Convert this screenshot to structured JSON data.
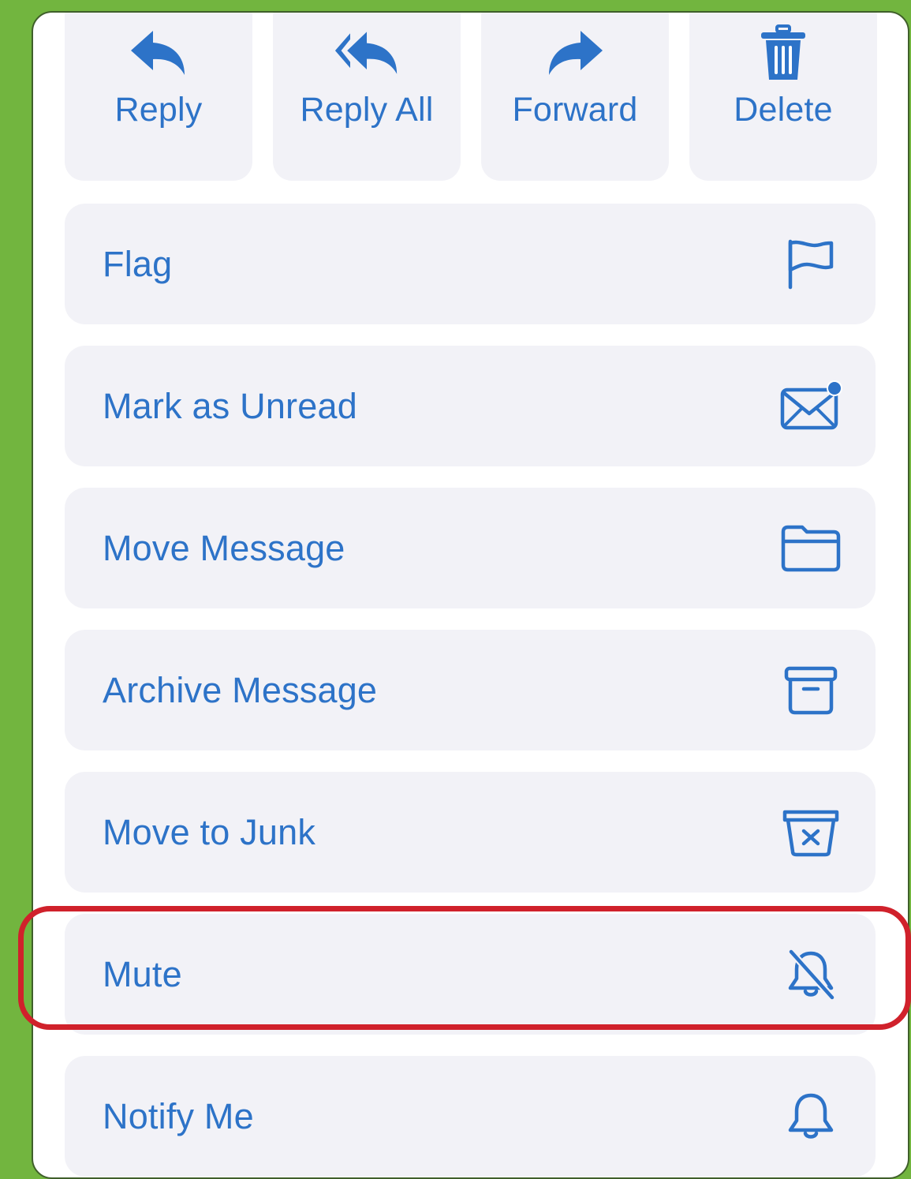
{
  "colors": {
    "accent": "#2d73c8",
    "page_background": "#72b53f",
    "row_background": "#f2f2f7",
    "highlight": "#d0212b"
  },
  "actions": [
    {
      "label": "Reply",
      "icon": "reply-icon"
    },
    {
      "label": "Reply All",
      "icon": "reply-all-icon"
    },
    {
      "label": "Forward",
      "icon": "forward-icon"
    },
    {
      "label": "Delete",
      "icon": "trash-icon"
    }
  ],
  "menu": [
    {
      "label": "Flag",
      "icon": "flag-icon"
    },
    {
      "label": "Mark as Unread",
      "icon": "envelope-unread-icon"
    },
    {
      "label": "Move Message",
      "icon": "folder-icon"
    },
    {
      "label": "Archive Message",
      "icon": "archive-box-icon"
    },
    {
      "label": "Move to Junk",
      "icon": "junk-box-icon"
    },
    {
      "label": "Mute",
      "icon": "bell-slash-icon",
      "highlighted": true
    },
    {
      "label": "Notify Me",
      "icon": "bell-icon"
    }
  ]
}
